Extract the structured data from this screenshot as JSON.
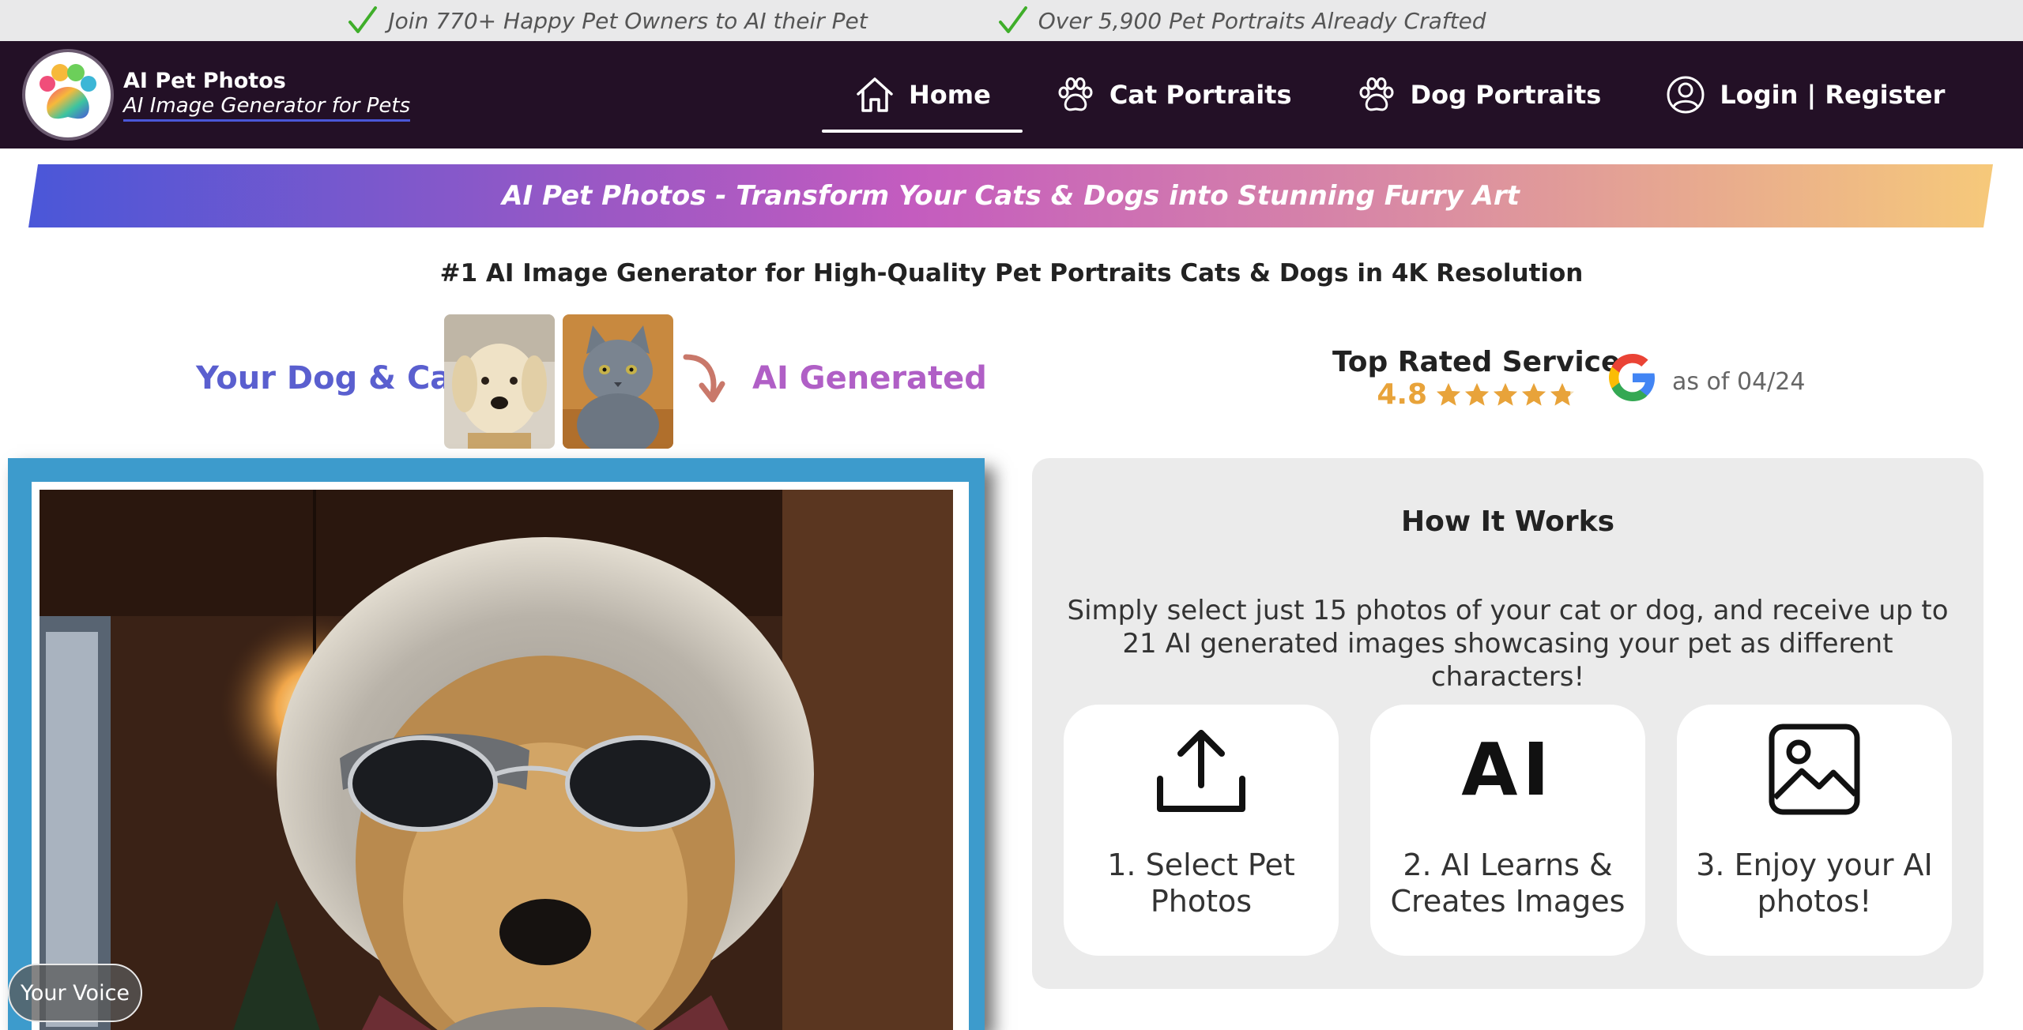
{
  "topbar": {
    "items": [
      "Join 770+ Happy Pet Owners to AI their Pet",
      "Over 5,900 Pet Portraits Already Crafted"
    ]
  },
  "brand": {
    "name": "AI Pet Photos",
    "tagline": "AI Image Generator for Pets"
  },
  "nav": {
    "items": [
      {
        "label": "Home",
        "icon": "home-icon"
      },
      {
        "label": "Cat Portraits",
        "icon": "paw-icon"
      },
      {
        "label": "Dog Portraits",
        "icon": "paw-icon"
      },
      {
        "label": "Login | Register",
        "icon": "user-icon"
      }
    ],
    "active": "Home"
  },
  "banner": {
    "text": "AI Pet Photos - Transform Your Cats & Dogs into Stunning Furry Art"
  },
  "headline": "#1 AI Image Generator for High-Quality Pet Portraits Cats & Dogs in 4K Resolution",
  "before_after": {
    "left_label": "Your Dog & Cat",
    "right_label": "AI Generated"
  },
  "rating": {
    "title": "Top Rated Service",
    "score": "4.8",
    "stars": 4.8,
    "as_of": "as of 04/24"
  },
  "voice": {
    "label": "Your Voice"
  },
  "how": {
    "title": "How It Works",
    "description": "Simply select just 15 photos of your cat or dog, and receive up to 21 AI generated images showcasing your pet as different characters!",
    "steps": [
      {
        "label": "1. Select Pet Photos",
        "icon": "upload-icon"
      },
      {
        "label": "2. AI Learns & Creates Images",
        "icon": "ai-icon",
        "glyph": "AI"
      },
      {
        "label": "3. Enjoy your AI photos!",
        "icon": "image-icon"
      }
    ]
  },
  "colors": {
    "nav_bg": "#231026",
    "frame": "#3d9bcc",
    "accent_blue": "#5a5fcf",
    "accent_purple": "#b05fc6",
    "rating_gold": "#e8a33a"
  }
}
